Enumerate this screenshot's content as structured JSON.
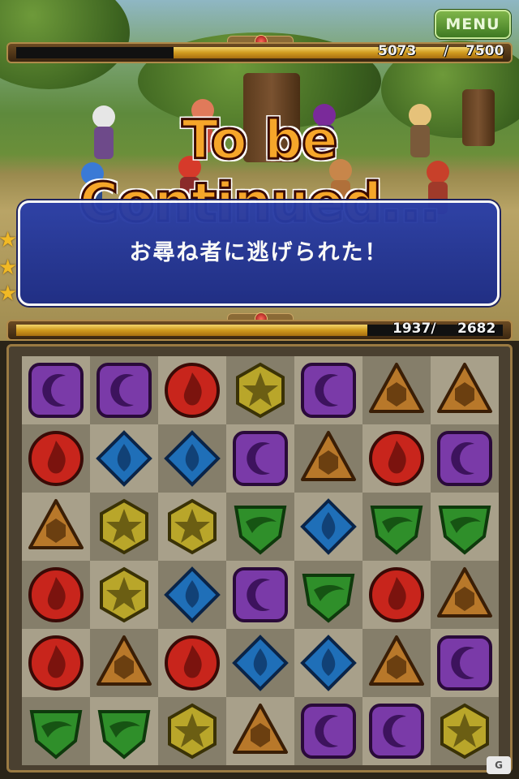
{
  "menu_label": "MENU",
  "enemy_hp": {
    "current_text": "5073",
    "sep": "/",
    "max_text": "7500",
    "current": 5073,
    "max": 7500
  },
  "party_hp": {
    "current_text": "1937/",
    "max_text": "2682",
    "current": 1937,
    "max": 2682
  },
  "banner_title": "To be Continued...",
  "message": "お尋ね者に逃げられた！",
  "stars_shown": 3,
  "board": {
    "rows": [
      [
        "dark",
        "dark",
        "fire",
        "light",
        "dark",
        "earth",
        "earth"
      ],
      [
        "fire",
        "water",
        "water",
        "dark",
        "earth",
        "fire",
        "dark"
      ],
      [
        "earth",
        "light",
        "light",
        "wind",
        "water",
        "wind",
        "wind"
      ],
      [
        "fire",
        "light",
        "water",
        "dark",
        "wind",
        "fire",
        "earth"
      ],
      [
        "fire",
        "earth",
        "fire",
        "water",
        "water",
        "earth",
        "dark"
      ],
      [
        "wind",
        "wind",
        "light",
        "earth",
        "dark",
        "dark",
        "light"
      ]
    ]
  },
  "orb_colors": {
    "fire": "#c8251c",
    "water": "#1f6fb8",
    "wind": "#2f8f2a",
    "light": "#b9a62a",
    "dark": "#7a3aa8",
    "earth": "#b8782a"
  },
  "logo_text": "G"
}
